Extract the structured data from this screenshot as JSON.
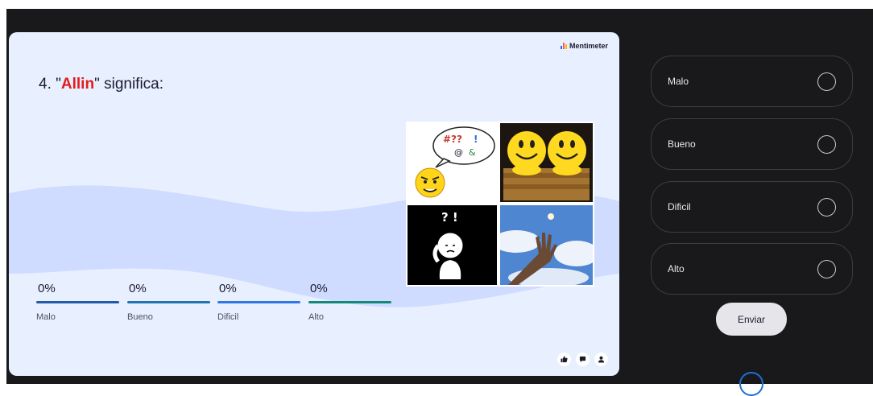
{
  "brand": {
    "name": "Mentimeter"
  },
  "question": {
    "number": "4.",
    "quote_open": "\"",
    "highlight": "Allin",
    "quote_close": "\"",
    "rest": " significa:"
  },
  "results": [
    {
      "percent": "0%",
      "label": "Malo",
      "value": 0,
      "color": "#215aa8"
    },
    {
      "percent": "0%",
      "label": "Bueno",
      "value": 0,
      "color": "#2273b3"
    },
    {
      "percent": "0%",
      "label": "Dificil",
      "value": 0,
      "color": "#2f76e8"
    },
    {
      "percent": "0%",
      "label": "Alto",
      "value": 0,
      "color": "#138a78"
    }
  ],
  "image_grid": {
    "speech_glyphs": "#?? ! @ &",
    "exclaim": "? !"
  },
  "reactions": [
    "thumbs-up-icon",
    "chat-icon",
    "audience-icon"
  ],
  "options": [
    {
      "label": "Malo",
      "selected": false
    },
    {
      "label": "Bueno",
      "selected": false
    },
    {
      "label": "Dificil",
      "selected": false
    },
    {
      "label": "Alto",
      "selected": false
    }
  ],
  "submit_label": "Enviar",
  "colors": {
    "slide_bg": "#e8efff",
    "wave": "#cfdcff",
    "highlight": "#e11d1d",
    "panel_bg": "#19191b"
  }
}
